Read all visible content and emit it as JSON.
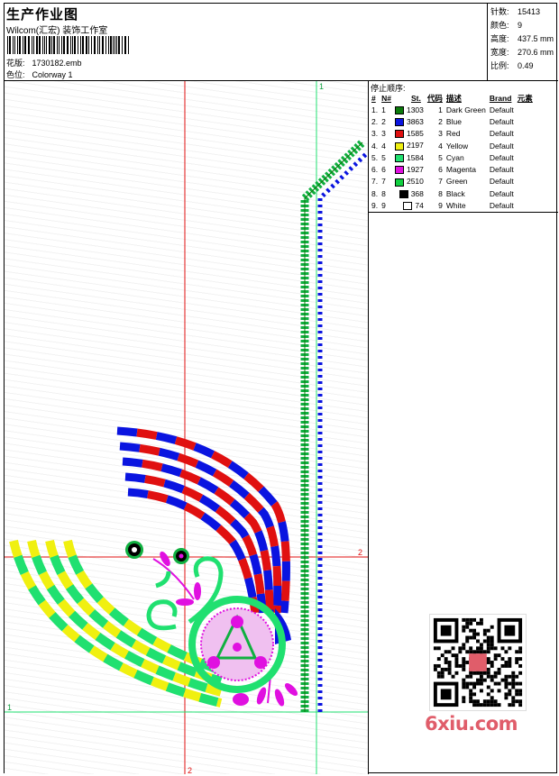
{
  "header": {
    "title": "生产作业图",
    "company": "Wilcom(汇宏) 装饰工作室",
    "design_label": "花版:",
    "design_file": "1730182.emb",
    "colorway_label": "色位:",
    "colorway": "Colorway 1"
  },
  "stats": [
    {
      "label": "针数:",
      "value": "15413"
    },
    {
      "label": "颜色:",
      "value": "9"
    },
    {
      "label": "高度:",
      "value": "437.5 mm"
    },
    {
      "label": "宽度:",
      "value": "270.6 mm"
    },
    {
      "label": "比例:",
      "value": "0.49"
    }
  ],
  "sequence": {
    "title": "停止顺序:",
    "columns": [
      "#",
      "N#",
      "St.",
      "代码",
      "描述",
      "Brand",
      "元素"
    ],
    "rows": [
      {
        "idx": "1.",
        "n": "1",
        "color": "#0b7a0b",
        "st": "1303",
        "code": "1",
        "desc": "Dark Green",
        "brand": "Default"
      },
      {
        "idx": "2.",
        "n": "2",
        "color": "#0a14e0",
        "st": "3863",
        "code": "2",
        "desc": "Blue",
        "brand": "Default"
      },
      {
        "idx": "3.",
        "n": "3",
        "color": "#e01010",
        "st": "1585",
        "code": "3",
        "desc": "Red",
        "brand": "Default"
      },
      {
        "idx": "4.",
        "n": "4",
        "color": "#f0f010",
        "st": "2197",
        "code": "4",
        "desc": "Yellow",
        "brand": "Default"
      },
      {
        "idx": "5.",
        "n": "5",
        "color": "#20e070",
        "st": "1584",
        "code": "5",
        "desc": "Cyan",
        "brand": "Default"
      },
      {
        "idx": "6.",
        "n": "6",
        "color": "#e010e0",
        "st": "1927",
        "code": "6",
        "desc": "Magenta",
        "brand": "Default"
      },
      {
        "idx": "7.",
        "n": "7",
        "color": "#10d040",
        "st": "2510",
        "code": "7",
        "desc": "Green",
        "brand": "Default"
      },
      {
        "idx": "8.",
        "n": "8",
        "color": "#000000",
        "st": "368",
        "code": "8",
        "desc": "Black",
        "brand": "Default"
      },
      {
        "idx": "9.",
        "n": "9",
        "color": "#ffffff",
        "st": "74",
        "code": "9",
        "desc": "White",
        "brand": "Default"
      }
    ]
  },
  "guides": {
    "h_top": "1",
    "v_right": "2",
    "v_bottom": "2",
    "h_left": "1"
  },
  "watermark": "6xiu.com"
}
